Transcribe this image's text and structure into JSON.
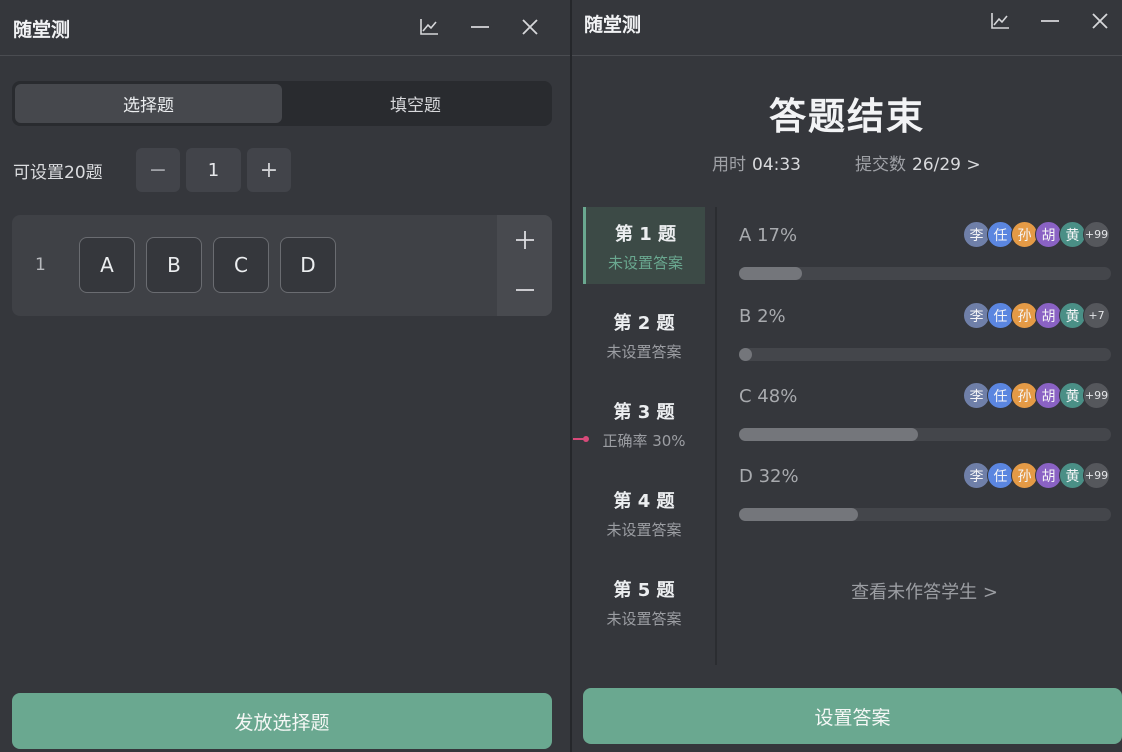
{
  "left": {
    "title": "随堂测",
    "tabs": [
      {
        "label": "选择题",
        "active": true
      },
      {
        "label": "填空题",
        "active": false
      }
    ],
    "count_label": "可设置20题",
    "stepper": {
      "minus": "−",
      "value": "1",
      "plus": "+"
    },
    "question": {
      "number": "1",
      "options": [
        "A",
        "B",
        "C",
        "D"
      ]
    },
    "publish_button": "发放选择题"
  },
  "right": {
    "title": "随堂测",
    "end_title": "答题结束",
    "time_label": "用时",
    "time_value": "04:33",
    "submit_label": "提交数",
    "submit_value": "26/29 >",
    "questions": [
      {
        "title": "第 1 题",
        "sub": "未设置答案",
        "active": true
      },
      {
        "title": "第 2 题",
        "sub": "未设置答案",
        "active": false
      },
      {
        "title": "第 3 题",
        "sub": "正确率 30%",
        "active": false
      },
      {
        "title": "第 4 题",
        "sub": "未设置答案",
        "active": false
      },
      {
        "title": "第 5 题",
        "sub": "未设置答案",
        "active": false
      }
    ],
    "options": [
      {
        "label": "A  17%",
        "percent": 17,
        "more": "+99"
      },
      {
        "label": "B  2%",
        "percent": 2,
        "more": "+7"
      },
      {
        "label": "C  48%",
        "percent": 48,
        "more": "+99"
      },
      {
        "label": "D  32%",
        "percent": 32,
        "more": "+99"
      }
    ],
    "avatars": [
      {
        "name": "李",
        "color": "#6f7fa8"
      },
      {
        "name": "任",
        "color": "#5b86e0"
      },
      {
        "name": "孙",
        "color": "#e49a46"
      },
      {
        "name": "胡",
        "color": "#8a62c4"
      },
      {
        "name": "黄",
        "color": "#4a8f86"
      }
    ],
    "view_unanswered": "查看未作答学生 >",
    "set_answer_button": "设置答案"
  },
  "colors": {
    "accent": "#6aa890",
    "panel": "#35373c",
    "marker": "#d84a7a"
  }
}
